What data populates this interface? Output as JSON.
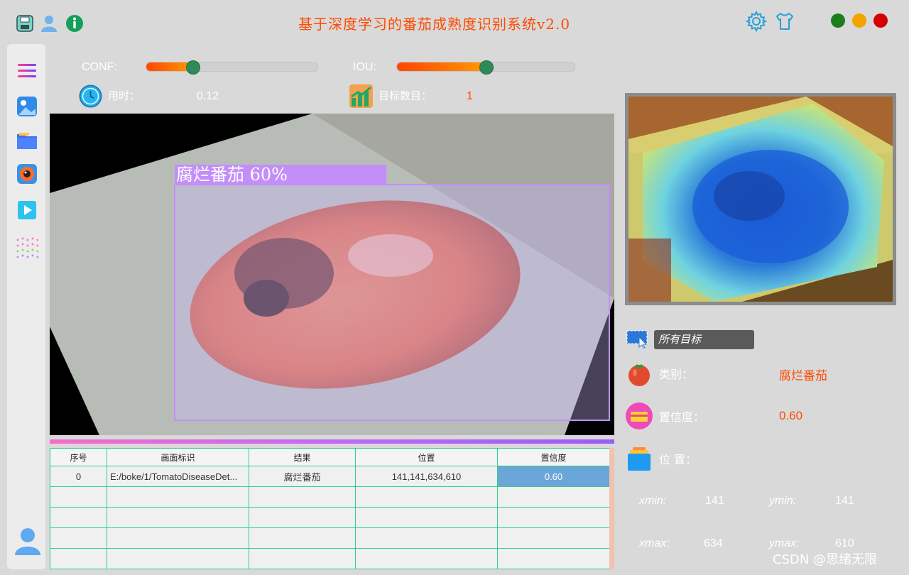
{
  "app": {
    "title": "基于深度学习的番茄成熟度识别系统v2.0",
    "accent_color": "#ff4a00"
  },
  "window_controls": {
    "close_color": "#1b7e1b",
    "minimize_color": "#f2a400",
    "maximize_color": "#d40000"
  },
  "top_icons": [
    "save-icon",
    "user-icon",
    "info-icon",
    "settings-gear-icon",
    "theme-shirt-icon"
  ],
  "sidebar": {
    "items": [
      "menu-icon",
      "image-file-icon",
      "folder-icon",
      "camera-icon",
      "video-play-icon",
      "dots-grid-icon",
      "user-avatar-icon"
    ]
  },
  "sliders": {
    "conf": {
      "label": "CONF:",
      "value_fraction": 0.27
    },
    "iou": {
      "label": "IOU:",
      "value_fraction": 0.5
    }
  },
  "stats": {
    "time_label": "用时：",
    "time_value": "0.12",
    "count_label": "目标数目：",
    "count_value": "1"
  },
  "detection": {
    "box_label": "腐烂番茄  60%",
    "box_color": "#c38ef8"
  },
  "table": {
    "headers": [
      "序号",
      "画面标识",
      "结果",
      "位置",
      "置信度"
    ],
    "rows": [
      [
        "0",
        "E:/boke/1/TomatoDiseaseDet...",
        "腐烂番茄",
        "141,141,634,610",
        "0.60"
      ],
      [
        "",
        "",
        "",
        "",
        ""
      ],
      [
        "",
        "",
        "",
        "",
        ""
      ],
      [
        "",
        "",
        "",
        "",
        ""
      ],
      [
        "",
        "",
        "",
        "",
        ""
      ]
    ]
  },
  "right_panel": {
    "target_select": "所有目标",
    "class_label": "类别：",
    "class_value": "腐烂番茄",
    "conf_label": "置信度：",
    "conf_value": "0.60",
    "position_label": "位  置：",
    "xmin_label": "xmin:",
    "xmin_value": "141",
    "ymin_label": "ymin:",
    "ymin_value": "141",
    "xmax_label": "xmax:",
    "xmax_value": "634",
    "ymax_label": "ymax:",
    "ymax_value": "610"
  },
  "watermark": "CSDN @思绪无限"
}
